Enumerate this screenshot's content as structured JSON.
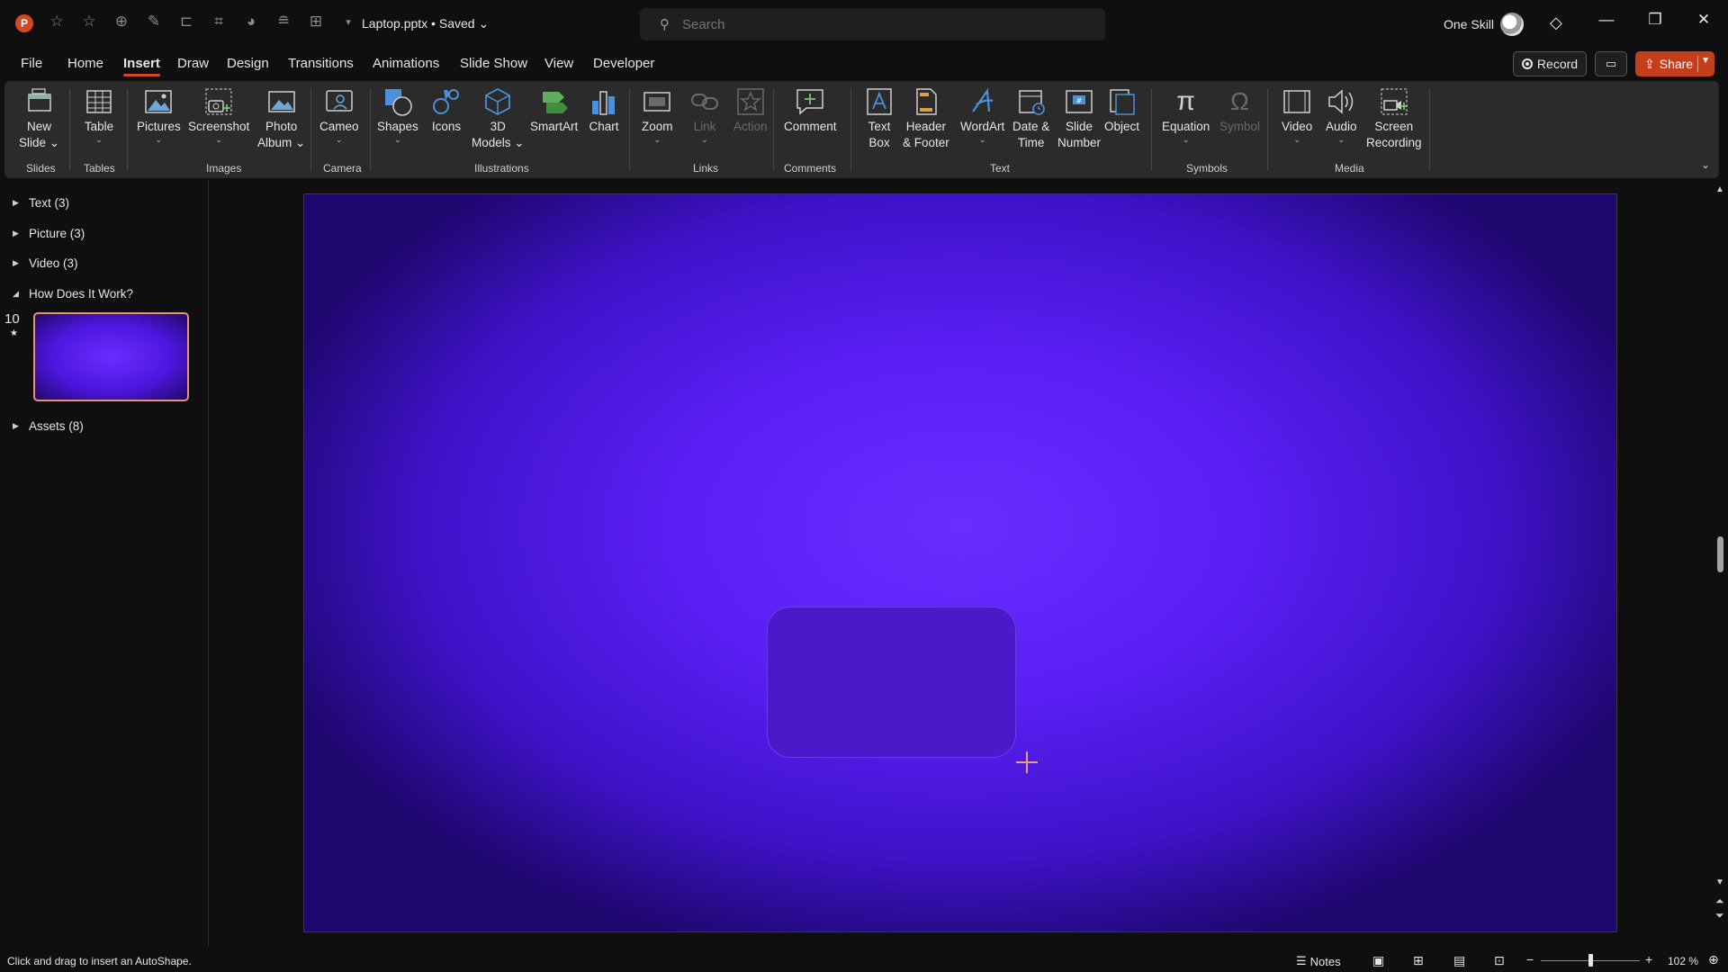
{
  "app": {
    "logo_letter": "P"
  },
  "title_bar": {
    "document": "Laptop.pptx • Saved ⌄",
    "search_placeholder": "Search",
    "user": "One Skill"
  },
  "menu": {
    "tabs": [
      "File",
      "Home",
      "Insert",
      "Draw",
      "Design",
      "Transitions",
      "Animations",
      "Slide Show",
      "View",
      "Developer"
    ],
    "active": "Insert",
    "record": "Record",
    "share": "Share"
  },
  "ribbon": {
    "buttons": {
      "new_slide": [
        "New",
        "Slide ⌄"
      ],
      "table": [
        "Table"
      ],
      "pictures": [
        "Pictures"
      ],
      "screenshot": [
        "Screenshot"
      ],
      "photo_album": [
        "Photo",
        "Album ⌄"
      ],
      "cameo": [
        "Cameo"
      ],
      "shapes": [
        "Shapes"
      ],
      "icons": [
        "Icons"
      ],
      "models_3d": [
        "3D",
        "Models ⌄"
      ],
      "smartart": [
        "SmartArt"
      ],
      "chart": [
        "Chart"
      ],
      "zoom": [
        "Zoom"
      ],
      "link": [
        "Link"
      ],
      "action": [
        "Action"
      ],
      "comment": [
        "Comment"
      ],
      "text_box": [
        "Text",
        "Box"
      ],
      "header_footer": [
        "Header",
        "& Footer"
      ],
      "wordart": [
        "WordArt"
      ],
      "date_time": [
        "Date &",
        "Time"
      ],
      "slide_number": [
        "Slide",
        "Number"
      ],
      "object": [
        "Object"
      ],
      "equation": [
        "Equation"
      ],
      "symbol": [
        "Symbol"
      ],
      "video": [
        "Video"
      ],
      "audio": [
        "Audio"
      ],
      "screen_recording": [
        "Screen",
        "Recording"
      ]
    },
    "groups": {
      "slides": "Slides",
      "tables": "Tables",
      "images": "Images",
      "camera": "Camera",
      "illustrations": "Illustrations",
      "links": "Links",
      "comments": "Comments",
      "text": "Text",
      "symbols": "Symbols",
      "media": "Media"
    }
  },
  "sections": {
    "text": "Text (3)",
    "picture": "Picture (3)",
    "video": "Video (3)",
    "how": "How Does It Work?",
    "assets": "Assets (8)"
  },
  "slide": {
    "number": "10"
  },
  "status": {
    "message": "Click and drag to insert an AutoShape.",
    "notes": "Notes",
    "zoom_level": "102 %",
    "zoom_fraction": 0.5
  }
}
